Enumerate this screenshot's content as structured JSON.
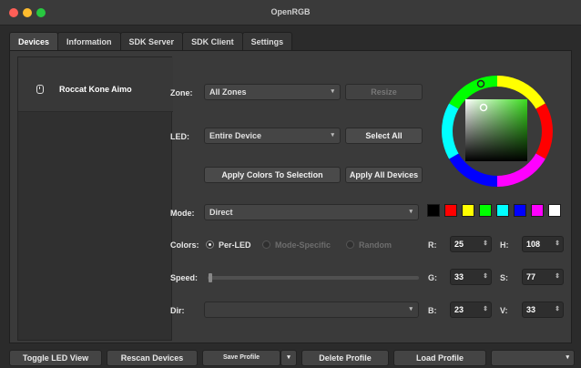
{
  "window": {
    "title": "OpenRGB"
  },
  "tabs": [
    "Devices",
    "Information",
    "SDK Server",
    "SDK Client",
    "Settings"
  ],
  "devices": [
    {
      "name": "Roccat Kone Aimo"
    }
  ],
  "zone": {
    "label": "Zone:",
    "value": "All Zones",
    "resize_label": "Resize"
  },
  "led": {
    "label": "LED:",
    "value": "Entire Device",
    "select_all_label": "Select All"
  },
  "actions": {
    "apply_selection": "Apply Colors To Selection",
    "apply_all": "Apply All Devices"
  },
  "mode": {
    "label": "Mode:",
    "value": "Direct"
  },
  "swatches": [
    "#000000",
    "#ff0000",
    "#ffff00",
    "#00ff00",
    "#00ffff",
    "#0000ff",
    "#ff00ff",
    "#ffffff"
  ],
  "colors": {
    "label": "Colors:",
    "options": [
      "Per-LED",
      "Mode-Specific",
      "Random"
    ],
    "selected": "Per-LED"
  },
  "speed": {
    "label": "Speed:"
  },
  "dir": {
    "label": "Dir:"
  },
  "rgb": {
    "r_label": "R:",
    "g_label": "G:",
    "b_label": "B:",
    "r": "25",
    "g": "33",
    "b": "23"
  },
  "hsv": {
    "h_label": "H:",
    "s_label": "S:",
    "v_label": "V:",
    "h": "108",
    "s": "77",
    "v": "33"
  },
  "bottom": {
    "toggle_led_view": "Toggle LED View",
    "rescan": "Rescan Devices",
    "save_profile": "Save Profile",
    "delete_profile": "Delete Profile",
    "load_profile": "Load Profile"
  },
  "icons": {
    "device": "mouse-icon"
  }
}
